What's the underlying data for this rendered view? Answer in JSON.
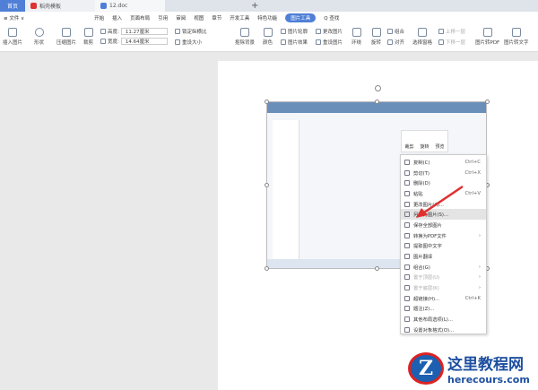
{
  "titlebar": {
    "tabs": [
      "首页",
      "稻壳模板",
      "12.doc"
    ],
    "add": "+"
  },
  "menubar": {
    "file": "≡ 文件 ∨",
    "tabs": [
      "开始",
      "插入",
      "页面布局",
      "引用",
      "审阅",
      "视图",
      "章节",
      "开发工具",
      "特色功能"
    ],
    "active": "图片工具",
    "search": "Q 查找"
  },
  "ribbon": {
    "insert_picture": "插入图片",
    "shape": "形状",
    "compress": "压缩图片",
    "crop": "裁剪",
    "height_label": "高度:",
    "height_value": "11.27厘米",
    "width_label": "宽度:",
    "width_value": "14.64厘米",
    "lock_ratio": "锁定纵横比",
    "reset_size": "重设大小",
    "remove_bg": "抠除背景",
    "color": "颜色",
    "outline": "图片轮廓",
    "effects": "图片效果",
    "change_pic": "更改图片",
    "reset_pic": "重设图片",
    "wrap": "环绕",
    "rotate": "旋转",
    "group": "组合",
    "align": "对齐",
    "select_pane": "选择窗格",
    "bring_forward": "上移一层",
    "send_backward": "下移一层",
    "to_pdf": "图片转PDF",
    "to_text": "图片转文字"
  },
  "mini_toolbar": [
    "裁剪",
    "旋转",
    "预览"
  ],
  "context_menu": [
    {
      "label": "复制(C)",
      "shortcut": "Ctrl+C"
    },
    {
      "label": "剪切(T)",
      "shortcut": "Ctrl+X"
    },
    {
      "label": "删除(D)",
      "shortcut": ""
    },
    {
      "label": "粘贴",
      "shortcut": "Ctrl+V"
    },
    {
      "label": "更改图片(A)...",
      "shortcut": ""
    },
    {
      "label": "另存为图片(S)...",
      "shortcut": "",
      "highlight": true
    },
    {
      "label": "保存全部图片",
      "shortcut": ""
    },
    {
      "label": "转换为PDF文件",
      "shortcut": "›"
    },
    {
      "label": "提取图中文字",
      "shortcut": ""
    },
    {
      "label": "图片翻译",
      "shortcut": ""
    },
    {
      "label": "组合(G)",
      "shortcut": "›"
    },
    {
      "label": "置于顶层(U)",
      "shortcut": "›",
      "disabled": true
    },
    {
      "label": "置于底层(K)",
      "shortcut": "›",
      "disabled": true
    },
    {
      "label": "超链接(H)...",
      "shortcut": "Ctrl+K"
    },
    {
      "label": "题注(Z)...",
      "shortcut": ""
    },
    {
      "label": "其他布局选项(L)...",
      "shortcut": ""
    },
    {
      "label": "设置对象格式(O)...",
      "shortcut": ""
    }
  ],
  "watermark": {
    "title": "这里教程网",
    "url": "herecours.com"
  },
  "colors": {
    "accent": "#4f7fd6",
    "arrow": "#e03030"
  }
}
